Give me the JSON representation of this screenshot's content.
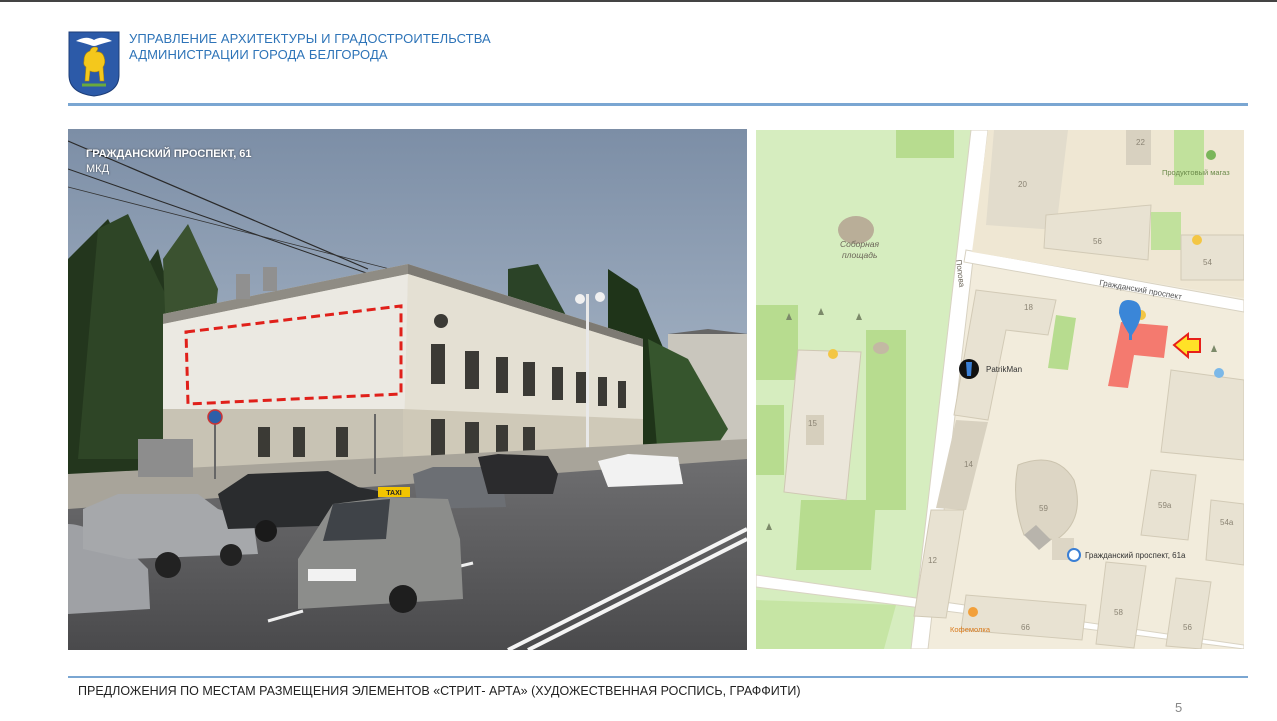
{
  "header": {
    "line1": "УПРАВЛЕНИЕ АРХИТЕКТУРЫ И ГРАДОСТРОИТЕЛЬСТВА",
    "line2": "АДМИНИСТРАЦИИ ГОРОДА БЕЛГОРОДА",
    "emblem_icon": "belgorod-coat-of-arms-icon"
  },
  "photo": {
    "address": "ГРАЖДАНСКИЙ ПРОСПЕКТ, 61",
    "type": "МКД",
    "taxi_sign": "TAXI"
  },
  "map": {
    "square_label_1": "Соборная",
    "square_label_2": "площадь",
    "street_popova": "Попова",
    "street_grazhdansky": "Гражданский проспект",
    "poi_patrikman": "PatrikMan",
    "poi_grocery": "Продуктовый магаз",
    "poi_address": "Гражданский проспект, 61а",
    "poi_cafe": "Кофемолка",
    "numbers": {
      "b20": "20",
      "b22": "22",
      "b56": "56",
      "b54": "54",
      "b18": "18",
      "b15": "15",
      "b14": "14",
      "b59": "59",
      "b59a": "59а",
      "b54a": "54а",
      "b12": "12",
      "b58": "58",
      "b56b": "56",
      "b66": "66"
    },
    "colors": {
      "land": "#f2ecdc",
      "park": "#c6e5a4",
      "building": "#e2dccc",
      "highlight": "#f47a6f",
      "arrow": "#ffe227"
    }
  },
  "footer": {
    "text": "ПРЕДЛОЖЕНИЯ ПО МЕСТАМ РАЗМЕЩЕНИЯ ЭЛЕМЕНТОВ «СТРИТ- АРТА» (ХУДОЖЕСТВЕННАЯ РОСПИСЬ, ГРАФФИТИ)",
    "page": "5"
  }
}
